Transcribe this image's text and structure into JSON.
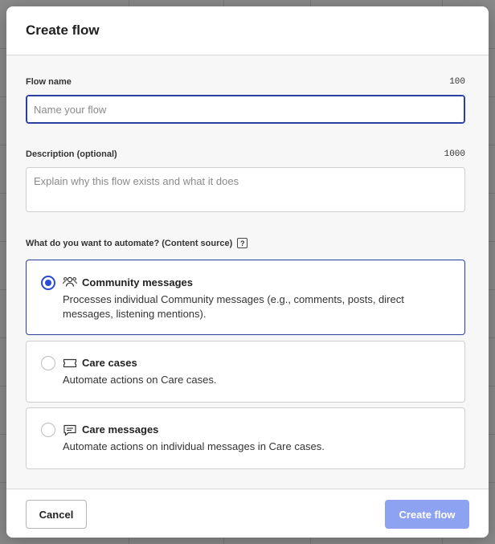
{
  "modal": {
    "title": "Create flow"
  },
  "flow_name": {
    "label": "Flow name",
    "limit": "100",
    "placeholder": "Name your flow",
    "value": ""
  },
  "description": {
    "label": "Description (optional)",
    "limit": "1000",
    "placeholder": "Explain why this flow exists and what it does",
    "value": ""
  },
  "content_source": {
    "question": "What do you want to automate? (Content source)",
    "help_icon": "?",
    "options": [
      {
        "title": "Community messages",
        "description": "Processes individual Community messages (e.g., comments, posts, direct messages, listening mentions).",
        "icon": "community-icon",
        "selected": true
      },
      {
        "title": "Care cases",
        "description": "Automate actions on Care cases.",
        "icon": "ticket-icon",
        "selected": false
      },
      {
        "title": "Care messages",
        "description": "Automate actions on individual messages in Care cases.",
        "icon": "message-icon",
        "selected": false
      }
    ]
  },
  "footer": {
    "cancel_label": "Cancel",
    "create_label": "Create flow"
  },
  "colors": {
    "accent": "#2b49d8",
    "create_button_disabled": "#8ea2f2",
    "overlay": "#8a8a8a"
  }
}
